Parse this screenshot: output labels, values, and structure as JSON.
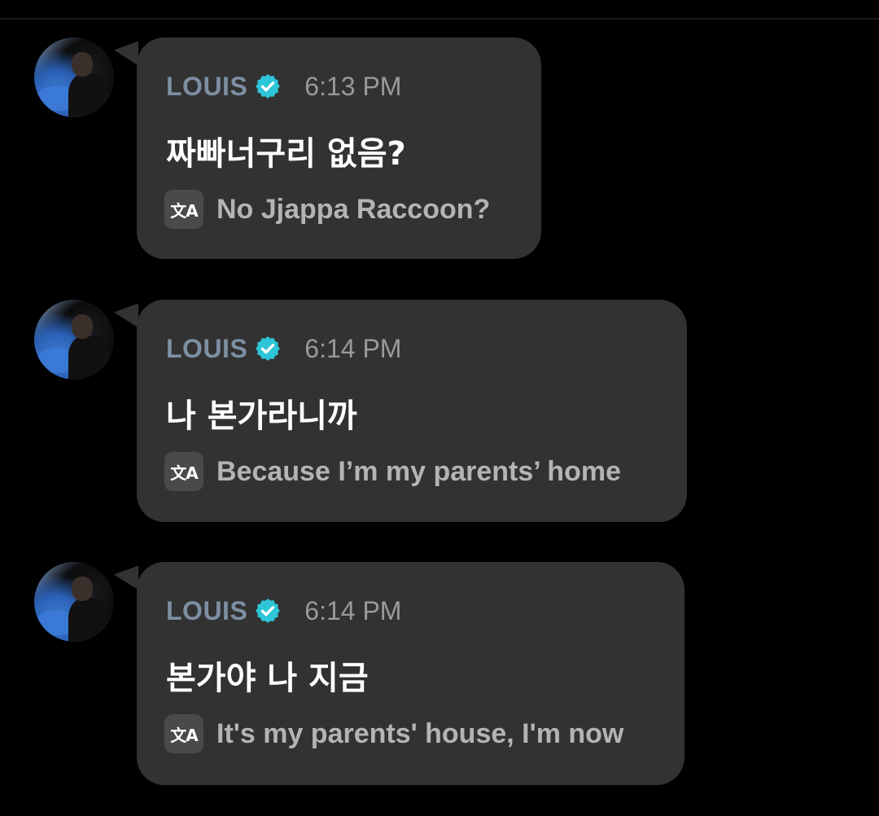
{
  "messages": [
    {
      "username": "LOUIS",
      "time": "6:13 PM",
      "text": "짜빠너구리 없음?",
      "translation": "No Jjappa Raccoon?"
    },
    {
      "username": "LOUIS",
      "time": "6:14 PM",
      "text": "나 본가라니까",
      "translation": "Because I’m my parents’ home"
    },
    {
      "username": "LOUIS",
      "time": "6:14 PM",
      "text": "본가야 나 지금",
      "translation": "It's my parents' house, I'm now"
    }
  ],
  "icons": {
    "verified": "verified-badge-icon",
    "translate": "translate-icon",
    "translate_glyph": "文A"
  },
  "colors": {
    "background": "#000000",
    "bubble": "#323232",
    "username": "#7d8fa3",
    "verified": "#2ec5d8",
    "timestamp": "#9a9a9a",
    "text": "#ffffff",
    "translation": "#b4b4b4"
  }
}
